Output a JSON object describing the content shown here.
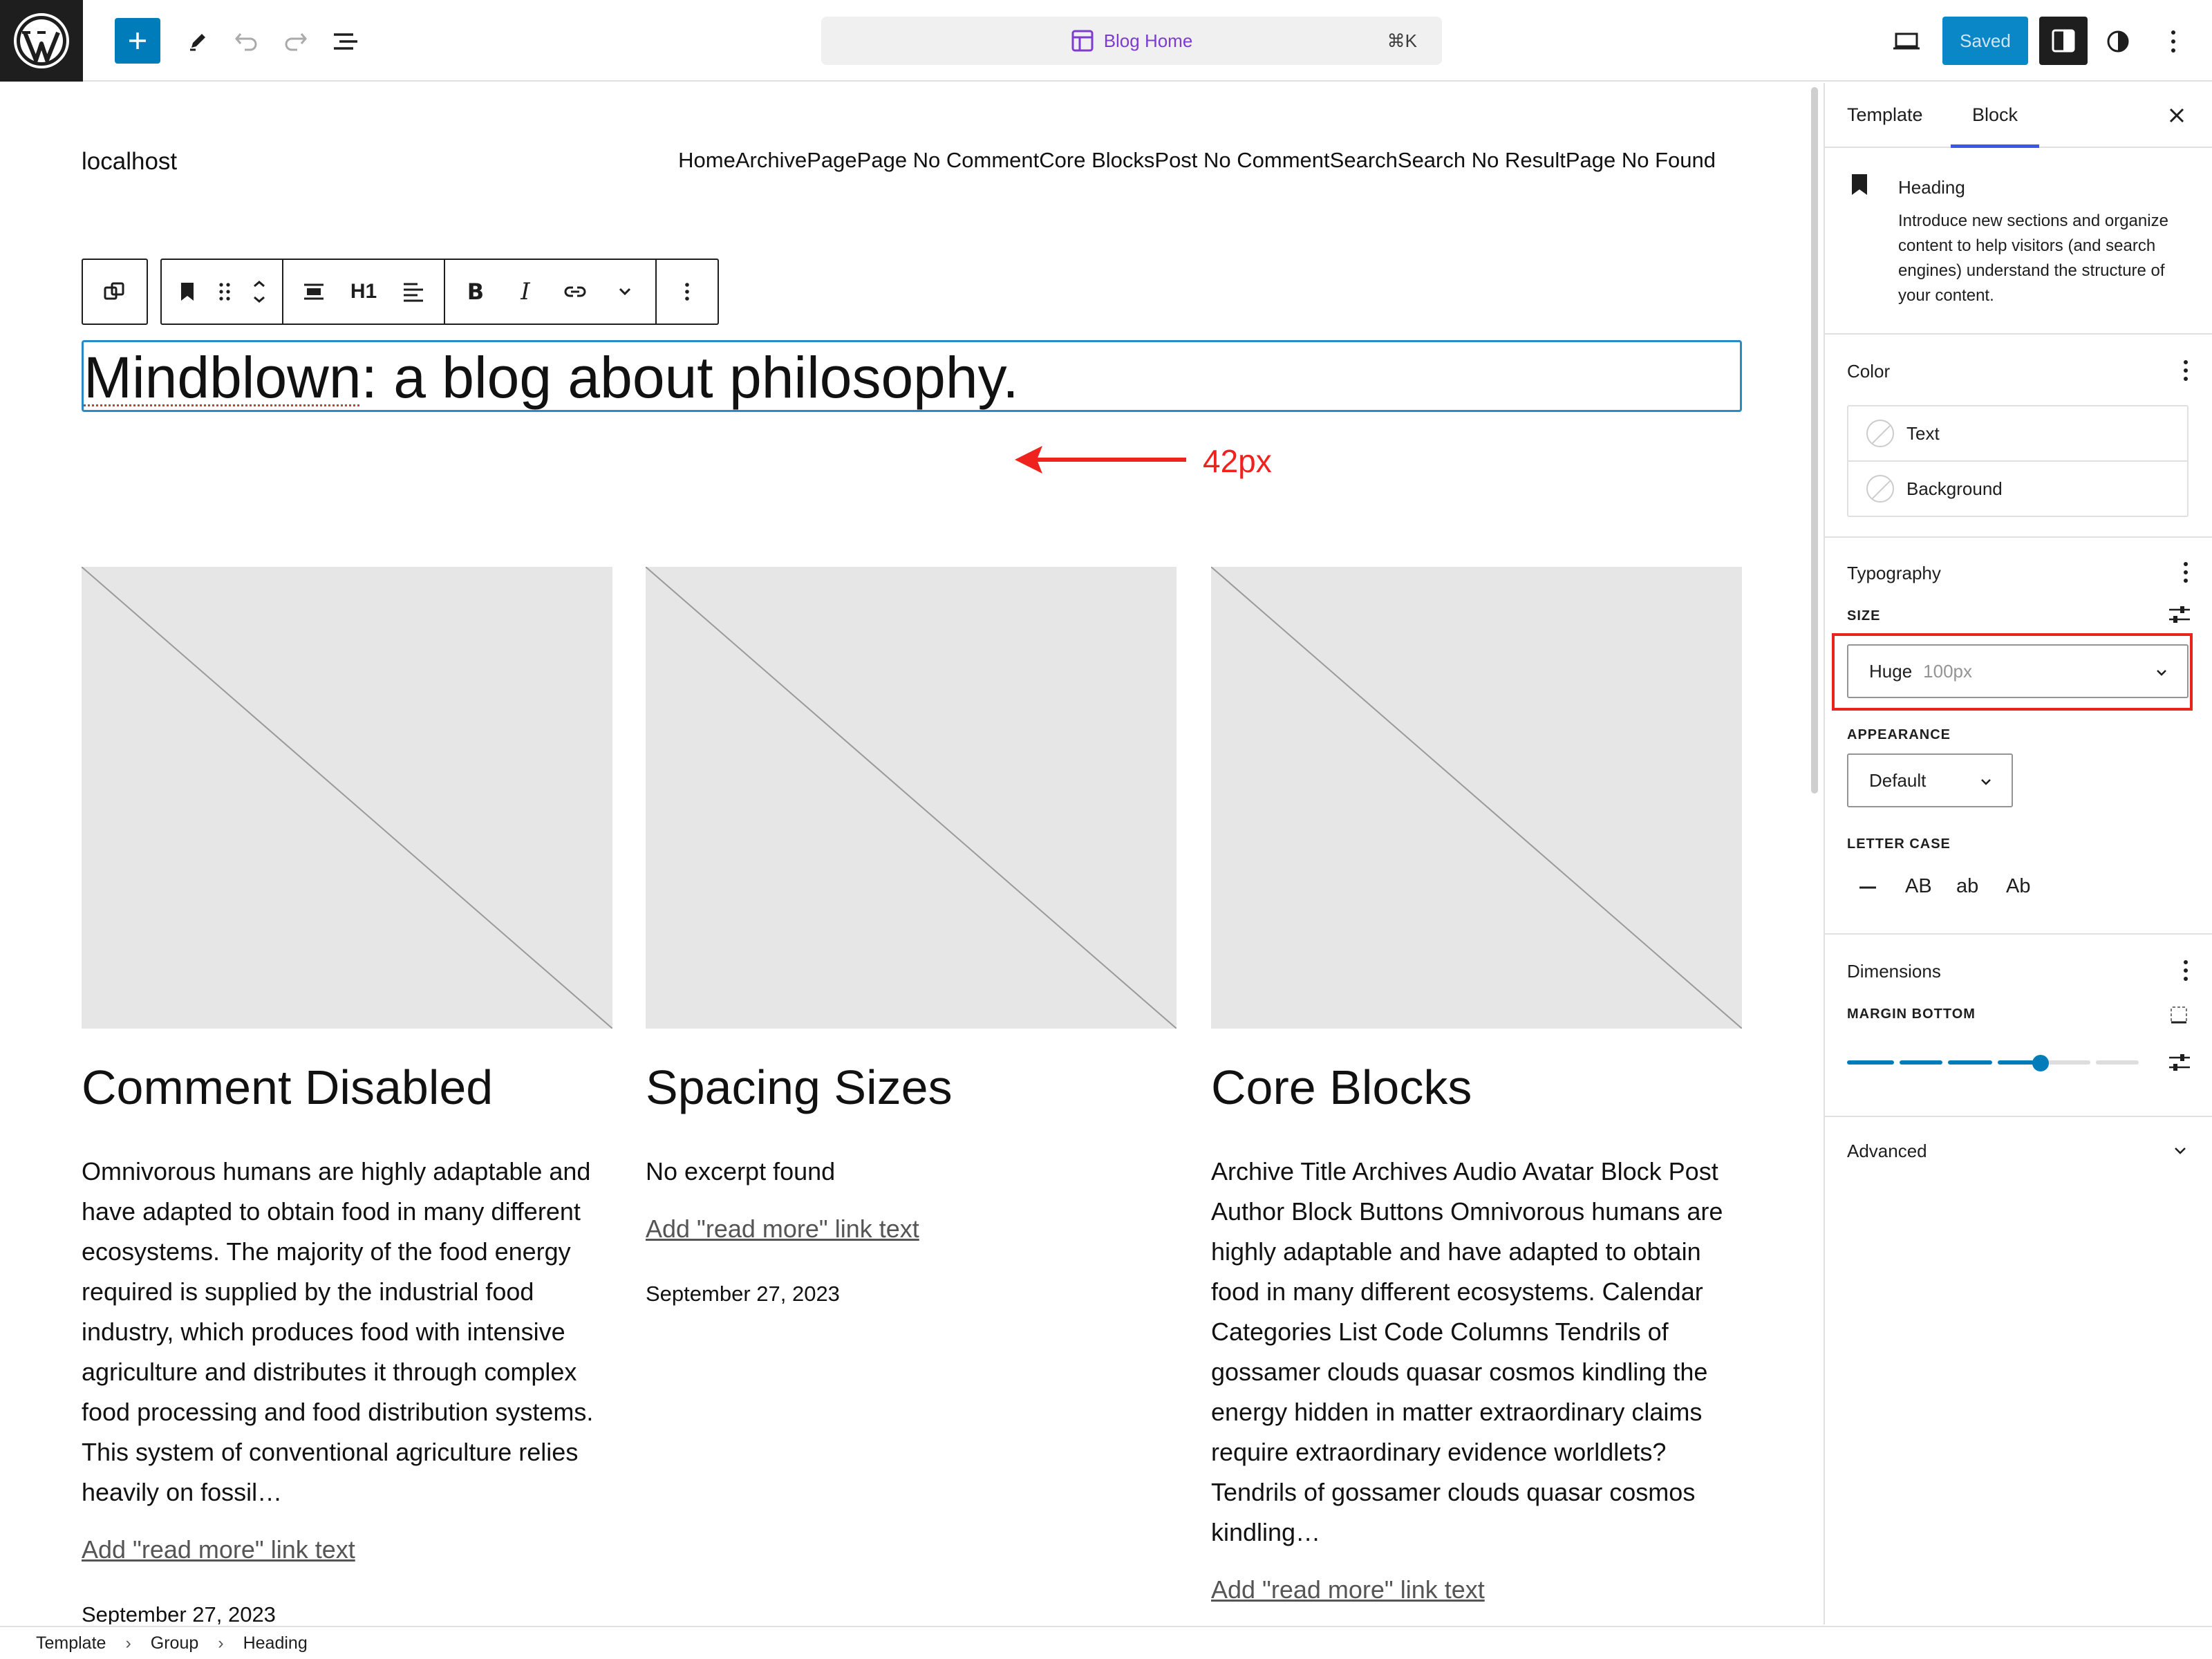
{
  "header": {
    "undo_label": "Undo",
    "document_title": "Blog Home",
    "shortcut": "⌘K",
    "saved_label": "Saved"
  },
  "site": {
    "title": "localhost",
    "nav": [
      "Home",
      "Archive",
      "Page",
      "Page No Comment",
      "Core Blocks",
      "Post No Comment",
      "Search",
      "Search No Result",
      "Page No Found"
    ]
  },
  "toolbar": {
    "heading_level": "H1",
    "bold": "B",
    "italic": "I"
  },
  "heading": {
    "word1": "Mindblown",
    "rest": ": a blog about philosophy."
  },
  "annotation": {
    "label": "42px",
    "color": "#f0221e"
  },
  "posts": [
    {
      "title": "Comment Disabled",
      "excerpt": "Omnivorous humans are highly adaptable and have adapted to obtain food in many different ecosystems. The majority of the food energy required is supplied by the industrial food industry, which produces food with intensive agriculture and distributes it through complex food processing and food distribution systems. This system of conventional agriculture relies heavily on fossil…",
      "more": "Add \"read more\" link text",
      "date": "September 27, 2023"
    },
    {
      "title": "Spacing Sizes",
      "excerpt": "No excerpt found",
      "more": "Add \"read more\" link text",
      "date": "September 27, 2023"
    },
    {
      "title": "Core Blocks",
      "excerpt": "Archive Title Archives Audio Avatar Block Post Author Block Buttons Omnivorous humans are highly adaptable and have adapted to obtain food in many different ecosystems. Calendar Categories List Code Columns Tendrils of gossamer clouds quasar cosmos kindling the energy hidden in matter extraordinary claims require extraordinary evidence worldlets? Tendrils of gossamer clouds quasar cosmos kindling…",
      "more": "Add \"read more\" link text",
      "date": ""
    }
  ],
  "sidebar": {
    "tabs": [
      "Template",
      "Block"
    ],
    "active_tab": "Block",
    "block": {
      "name": "Heading",
      "description": "Introduce new sections and organize content to help visitors (and search engines) understand the structure of your content."
    },
    "color": {
      "title": "Color",
      "items": [
        "Text",
        "Background"
      ]
    },
    "typography": {
      "title": "Typography",
      "size_label": "SIZE",
      "size_value": "Huge",
      "size_px": "100px",
      "appearance_label": "APPEARANCE",
      "appearance_value": "Default",
      "letter_case_label": "LETTER CASE",
      "letter_case_options": [
        "AB",
        "ab",
        "Ab"
      ]
    },
    "dimensions": {
      "title": "Dimensions",
      "margin_label": "MARGIN BOTTOM",
      "margin_level": 0.67
    },
    "advanced": {
      "title": "Advanced"
    }
  },
  "breadcrumb": [
    "Template",
    "Group",
    "Heading"
  ],
  "colors": {
    "accent": "#007cba",
    "tab_indicator": "#3858e9",
    "highlight": "#e8251d"
  }
}
